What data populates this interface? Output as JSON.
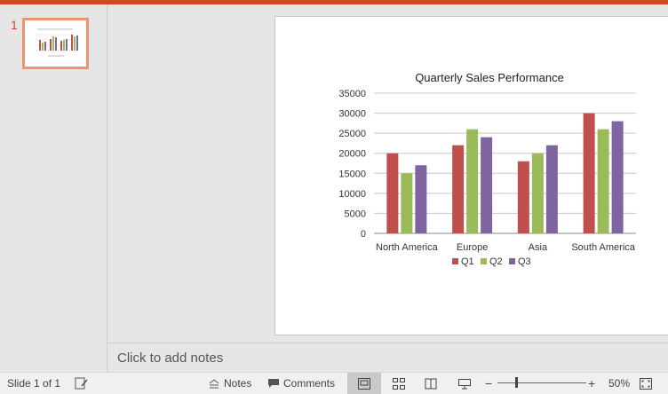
{
  "thumbnail": {
    "number": "1"
  },
  "notes": {
    "placeholder": "Click to add notes"
  },
  "statusbar": {
    "slide_info": "Slide 1 of 1",
    "notes_label": "Notes",
    "comments_label": "Comments",
    "zoom_level": "50%",
    "zoom_minus": "−",
    "zoom_plus": "+"
  },
  "colors": {
    "accent": "#d24726",
    "q1": "#c0504d",
    "q2": "#9bbb59",
    "q3": "#8064a2"
  },
  "chart_data": {
    "type": "bar",
    "title": "Quarterly Sales Performance",
    "categories": [
      "North America",
      "Europe",
      "Asia",
      "South America"
    ],
    "series": [
      {
        "name": "Q1",
        "values": [
          20000,
          22000,
          18000,
          30000
        ]
      },
      {
        "name": "Q2",
        "values": [
          15000,
          26000,
          20000,
          26000
        ]
      },
      {
        "name": "Q3",
        "values": [
          17000,
          24000,
          22000,
          28000
        ]
      }
    ],
    "yticks": [
      "0",
      "5000",
      "10000",
      "15000",
      "20000",
      "25000",
      "30000",
      "35000"
    ],
    "ylim": [
      0,
      35000
    ],
    "grid": true,
    "legend": "bottom",
    "xlabel": "",
    "ylabel": ""
  }
}
